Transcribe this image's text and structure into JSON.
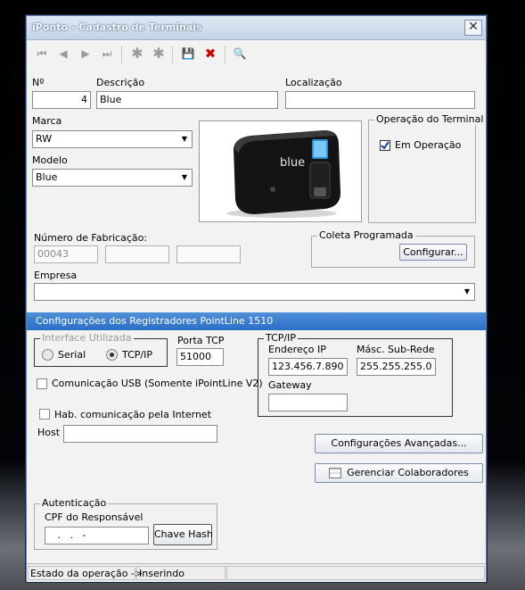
{
  "window": {
    "title": "iPonto - Cadastro de Terminais",
    "close_glyph": "✕"
  },
  "toolbar": {
    "first_icon": "⏮",
    "prev_icon": "◀",
    "next_icon": "▶",
    "last_icon": "⏭",
    "new_icon": "✱",
    "delete_icon": "✱",
    "save_icon": "💾",
    "cancel_icon": "✖",
    "preview_icon": "🔍"
  },
  "form": {
    "num_label": "Nº",
    "num_value": "4",
    "descricao_label": "Descrição",
    "descricao_value": "Blue",
    "localizacao_label": "Localização",
    "localizacao_value": "",
    "marca_label": "Marca",
    "marca_value": "RW",
    "modelo_label": "Modelo",
    "modelo_value": "Blue",
    "operacao_group": "Operação do Terminal",
    "em_operacao_label": "Em Operação",
    "em_operacao_checked": true,
    "fabricacao_label": "Número de Fabricação:",
    "fabricacao_1": "00043",
    "fabricacao_2": "",
    "fabricacao_3": "",
    "coleta_group": "Coleta Programada",
    "configurar_button": "Configurar...",
    "empresa_label": "Empresa",
    "empresa_value": ""
  },
  "registradores": {
    "header": "Configurações dos Registradores PointLine 1510",
    "interface_group": "Interface Utilizada",
    "serial_label": "Serial",
    "tcpip_label": "TCP/IP",
    "selected": "TCP/IP",
    "porta_label": "Porta TCP",
    "porta_value": "51000",
    "usb_label": "Comunicação USB (Somente iPointLine V2)",
    "internet_label": "Hab. comunicação pela Internet",
    "host_label": "Host",
    "host_value": "",
    "tcp_group": "TCP/IP",
    "endereco_label": "Endereço IP",
    "endereco_value": "123.456.7.890",
    "mascara_label": "Másc. Sub-Rede",
    "mascara_value": "255.255.255.0",
    "gateway_label": "Gateway",
    "gateway_value": "",
    "config_avancadas_button": "Configurações Avançadas...",
    "gerenciar_button": "Gerenciar Colaboradores",
    "auth_group": "Autenticação",
    "cpf_label": "CPF do Responsável",
    "cpf_value": "   .   .   -",
    "chave_button": "Chave Hash"
  },
  "device_brand": "blue",
  "status": {
    "label": "Estado da operação ->",
    "value": "Inserindo",
    "extra": ""
  }
}
